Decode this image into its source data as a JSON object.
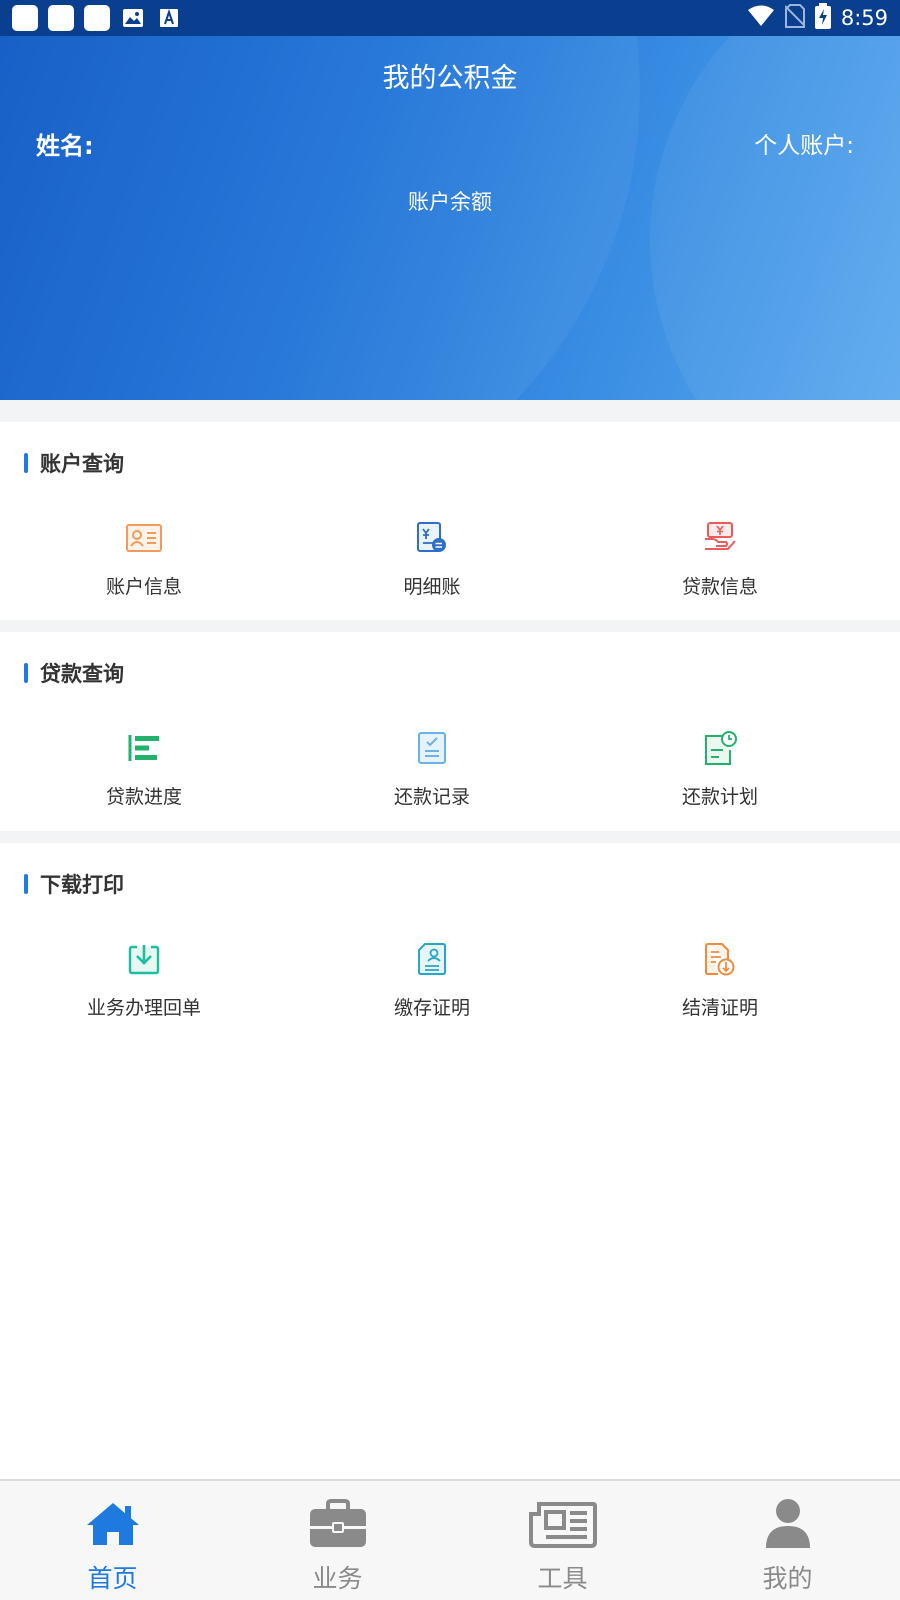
{
  "status_bar": {
    "time": "8:59"
  },
  "header": {
    "title": "我的公积金",
    "name_label": "姓名:",
    "account_label": "个人账户:",
    "balance_label": "账户余额"
  },
  "sections": [
    {
      "title": "账户查询",
      "items": [
        {
          "label": "账户信息",
          "icon": "id-card-icon"
        },
        {
          "label": "明细账",
          "icon": "ledger-icon"
        },
        {
          "label": "贷款信息",
          "icon": "loan-info-icon"
        }
      ]
    },
    {
      "title": "贷款查询",
      "items": [
        {
          "label": "贷款进度",
          "icon": "progress-icon"
        },
        {
          "label": "还款记录",
          "icon": "repay-record-icon"
        },
        {
          "label": "还款计划",
          "icon": "repay-plan-icon"
        }
      ]
    },
    {
      "title": "下载打印",
      "items": [
        {
          "label": "业务办理回单",
          "icon": "download-icon"
        },
        {
          "label": "缴存证明",
          "icon": "deposit-certificate-icon"
        },
        {
          "label": "结清证明",
          "icon": "settlement-certificate-icon"
        }
      ]
    }
  ],
  "bottom_nav": [
    {
      "label": "首页",
      "icon": "home-icon",
      "active": true
    },
    {
      "label": "业务",
      "icon": "briefcase-icon",
      "active": false
    },
    {
      "label": "工具",
      "icon": "newspaper-icon",
      "active": false
    },
    {
      "label": "我的",
      "icon": "user-icon",
      "active": false
    }
  ],
  "colors": {
    "accent": "#1f7ae0",
    "header_start": "#0b57c4",
    "header_end": "#5aa8ee",
    "nav_inactive": "#8a8a8a"
  }
}
